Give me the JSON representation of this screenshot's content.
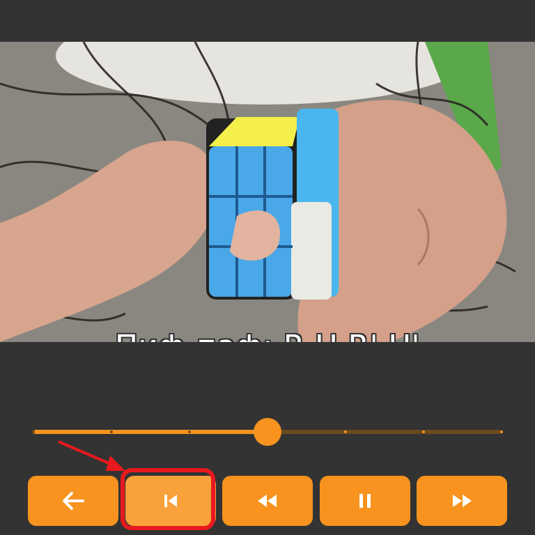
{
  "video": {
    "subtitle": "Пиф-паф: R U R' U'"
  },
  "seekbar": {
    "progress": 0.5,
    "tick_positions": [
      0.0,
      0.1667,
      0.3333,
      0.6667,
      0.8333,
      1.0
    ],
    "colors": {
      "played": "#f7931e",
      "remaining": "#6b4a1e"
    }
  },
  "controls": [
    {
      "name": "back-button",
      "icon": "arrow-left-icon"
    },
    {
      "name": "previous-step-button",
      "icon": "skip-previous-icon"
    },
    {
      "name": "rewind-button",
      "icon": "rewind-icon"
    },
    {
      "name": "pause-button",
      "icon": "pause-icon"
    },
    {
      "name": "fast-forward-button",
      "icon": "fast-forward-icon"
    }
  ],
  "annotation": {
    "highlighted_control": "previous-step-button",
    "color": "#e8191e"
  },
  "theme": {
    "accent": "#f7931e",
    "background": "#333333"
  }
}
